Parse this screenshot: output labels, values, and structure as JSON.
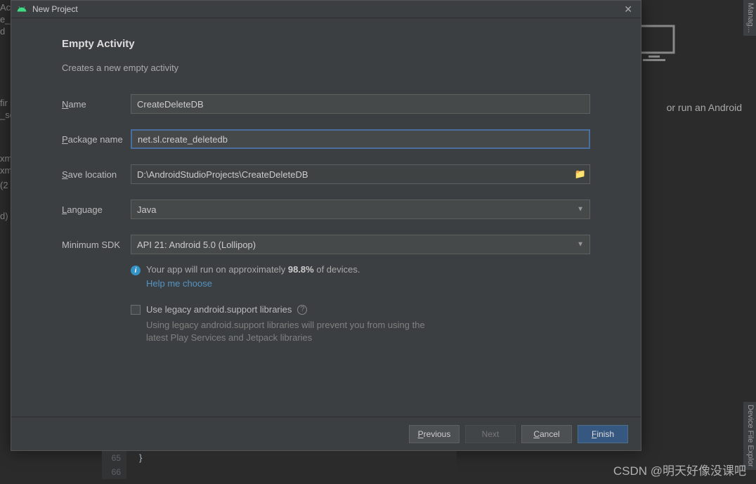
{
  "dialog": {
    "title": "New Project",
    "heading": "Empty Activity",
    "subtitle": "Creates a new empty activity"
  },
  "form": {
    "name": {
      "label": "Name",
      "value": "CreateDeleteDB"
    },
    "package": {
      "label": "Package name",
      "value": "net.sl.create_deletedb"
    },
    "saveLocation": {
      "label": "Save location",
      "value": "D:\\AndroidStudioProjects\\CreateDeleteDB"
    },
    "language": {
      "label": "Language",
      "value": "Java"
    },
    "minSdk": {
      "label": "Minimum SDK",
      "value": "API 21: Android 5.0 (Lollipop)"
    }
  },
  "info": {
    "textPrefix": "Your app will run on approximately ",
    "percent": "98.8%",
    "textSuffix": " of devices.",
    "helpLink": "Help me choose"
  },
  "legacy": {
    "checkboxLabel": "Use legacy android.support libraries",
    "note": "Using legacy android.support libraries will prevent you from using the latest Play Services and Jetpack libraries"
  },
  "buttons": {
    "previous": "Previous",
    "next": "Next",
    "cancel": "Cancel",
    "finish": "Finish"
  },
  "background": {
    "runText": "or run an Android",
    "lines": [
      "65",
      "66"
    ],
    "codeLine": "}",
    "frag1": "Ac",
    "frag2": "e_c",
    "frag3": "d",
    "frag4": "fir",
    "frag5": "_se",
    "frag6": "xm",
    "frag7": "xm",
    "frag8": "(2",
    "frag9": "d)"
  },
  "watermark": "CSDN @明天好像没课吧"
}
